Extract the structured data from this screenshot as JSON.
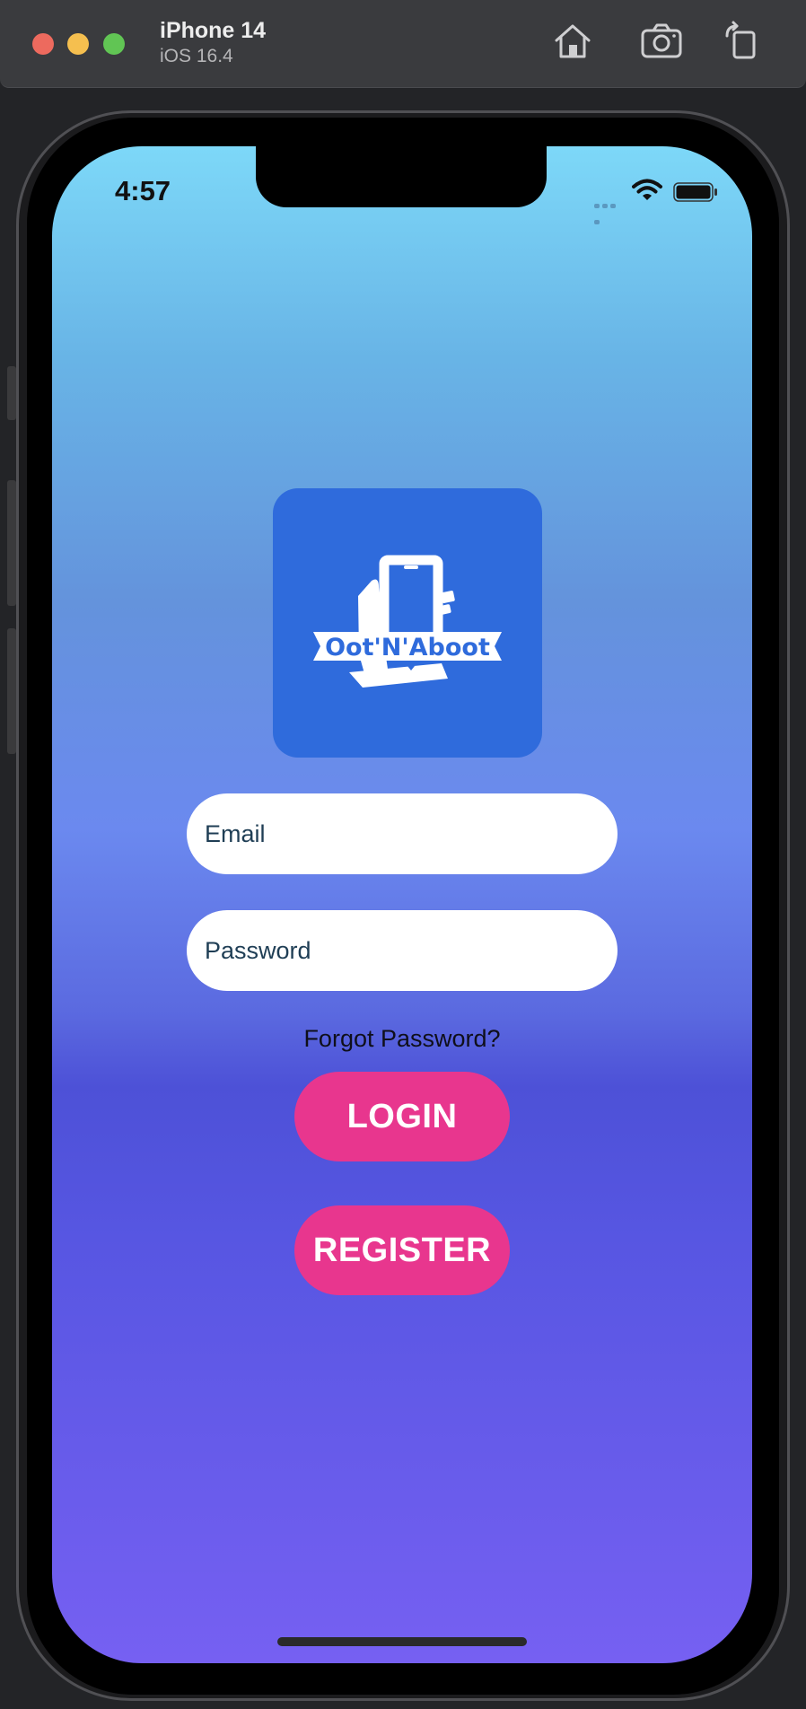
{
  "simulator": {
    "device_name": "iPhone 14",
    "os_version": "iOS 16.4",
    "icons": [
      "home-icon",
      "screenshot-icon",
      "rotate-icon"
    ]
  },
  "status_bar": {
    "time": "4:57",
    "icons": [
      "wifi-icon",
      "battery-icon"
    ]
  },
  "app": {
    "logo_text": "Oot'N'Aboot",
    "email_placeholder": "Email",
    "password_placeholder": "Password",
    "forgot_password": "Forgot Password?",
    "login_label": "LOGIN",
    "register_label": "REGISTER"
  },
  "colors": {
    "logo_bg": "#2f6bdc",
    "button_bg": "#e8368e",
    "gradient_top": "#7dd8f8",
    "gradient_bottom": "#7660f2"
  }
}
